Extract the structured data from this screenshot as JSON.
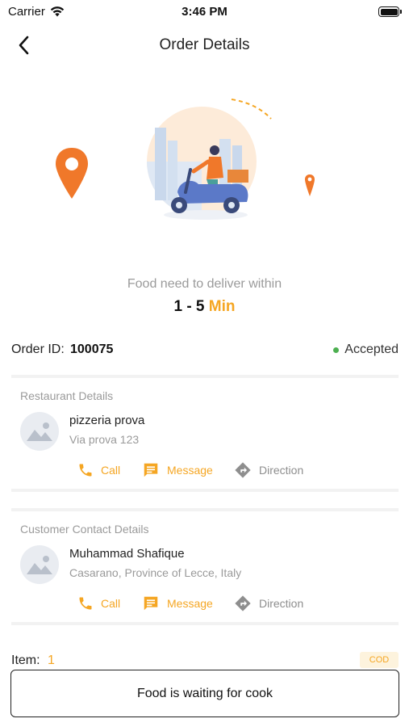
{
  "status_bar": {
    "carrier": "Carrier",
    "time": "3:46 PM"
  },
  "nav": {
    "title": "Order Details"
  },
  "delivery": {
    "text": "Food need to deliver within",
    "range": "1 - 5",
    "unit": "Min"
  },
  "order": {
    "id_label": "Order ID:",
    "id": "100075",
    "status": "Accepted",
    "status_color": "#4caf50"
  },
  "restaurant": {
    "title": "Restaurant Details",
    "name": "pizzeria prova",
    "address": "Via prova 123",
    "actions": {
      "call": "Call",
      "message": "Message",
      "direction": "Direction"
    }
  },
  "customer": {
    "title": "Customer Contact Details",
    "name": "Muhammad Shafique",
    "address": "Casarano, Province of Lecce, Italy",
    "actions": {
      "call": "Call",
      "message": "Message",
      "direction": "Direction"
    }
  },
  "items": {
    "label": "Item:",
    "count": "1",
    "payment": "COD"
  },
  "footer": {
    "status_button": "Food is waiting for cook"
  },
  "colors": {
    "accent": "#f5a623",
    "muted": "#9a9a9a",
    "pin": "#f0782a"
  },
  "icons": [
    "wifi-icon",
    "battery-icon",
    "back-chevron-icon",
    "location-pin-icon",
    "delivery-scooter-icon",
    "phone-icon",
    "message-icon",
    "direction-icon",
    "image-placeholder-icon"
  ]
}
